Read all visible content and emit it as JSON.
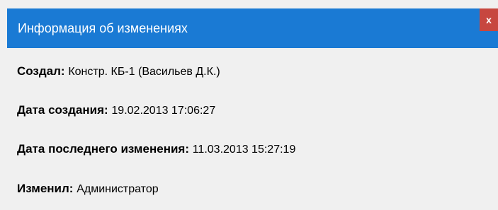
{
  "window": {
    "title": "Информация об изменениях",
    "close_label": "x"
  },
  "fields": [
    {
      "label": "Создал:",
      "value": "Констр. КБ-1 (Васильев Д.К.)"
    },
    {
      "label": "Дата создания:",
      "value": "19.02.2013 17:06:27"
    },
    {
      "label": "Дата последнего изменения:",
      "value": "11.03.2013 15:27:19"
    },
    {
      "label": "Изменил:",
      "value": "Администратор"
    }
  ],
  "colors": {
    "titlebar": "#1a7ad4",
    "close_button": "#c7473f",
    "background": "#f0f0f0"
  }
}
